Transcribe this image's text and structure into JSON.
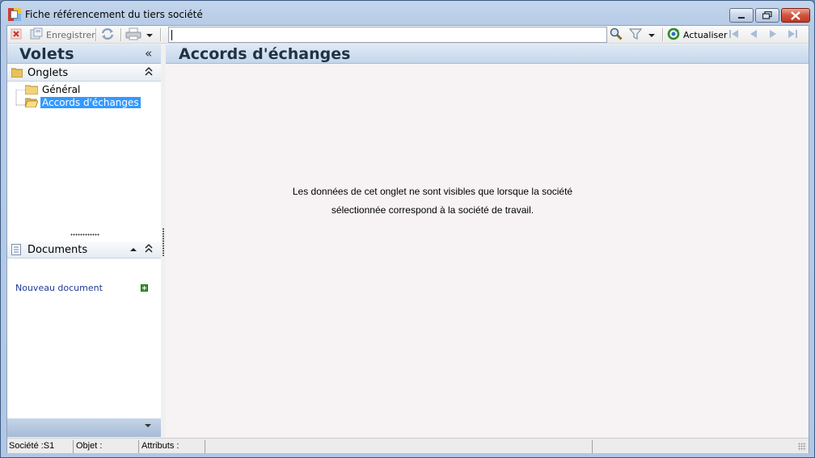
{
  "window": {
    "title": "Fiche référencement du tiers société"
  },
  "toolbar": {
    "save_label": "Enregistrer",
    "refresh_label": "Actualiser",
    "search": {
      "value": "",
      "placeholder": ""
    }
  },
  "left_panel": {
    "title": "Volets",
    "onglets": {
      "title": "Onglets",
      "items": [
        {
          "label": "Général",
          "selected": false
        },
        {
          "label": "Accords d'échanges",
          "selected": true
        }
      ]
    },
    "documents": {
      "title": "Documents",
      "new_document_label": "Nouveau document"
    }
  },
  "content": {
    "title": "Accords d'échanges",
    "message_line1": "Les données de cet onglet ne sont visibles que lorsque la société",
    "message_line2": "sélectionnée correspond à la société de travail."
  },
  "statusbar": {
    "societe": "Société :S1",
    "objet": "Objet :",
    "attributs": "Attributs :"
  },
  "colors": {
    "selection": "#3399ff",
    "header_text": "#1f3346",
    "link": "#1f3a93"
  }
}
